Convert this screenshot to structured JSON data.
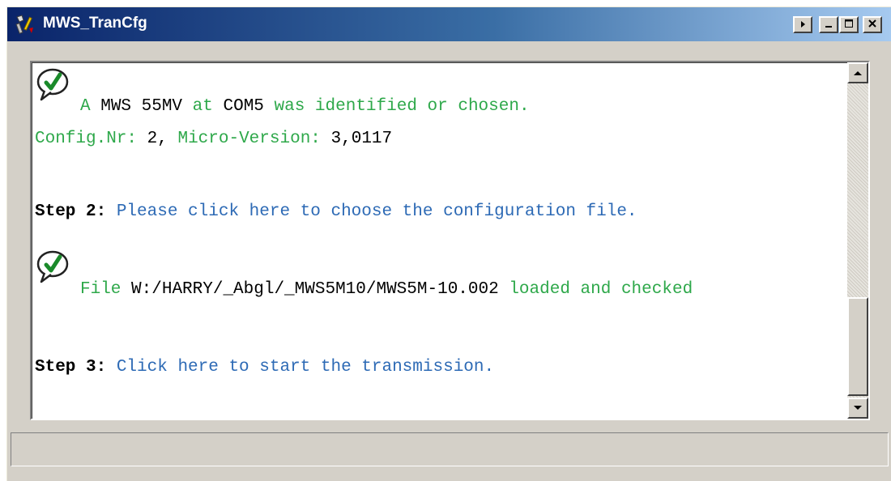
{
  "window": {
    "title": "MWS_TranCfg",
    "title_icon": "tools-icon",
    "titlebar_color_start": "#0a246a",
    "titlebar_color_end": "#a6caf0",
    "buttons": [
      "menu-arrow-icon",
      "minimize-icon",
      "maximize-icon",
      "close-icon"
    ]
  },
  "log": {
    "device": {
      "icon": "check-bubble-icon",
      "t1": "A",
      "t2": "MWS 55MV",
      "t3": "at",
      "t4": "COM5",
      "t5": "was identified or chosen."
    },
    "config": {
      "label": "Config.Nr:",
      "nr": "2,",
      "micro_label": "Micro-Version:",
      "micro_value": "3,0117"
    },
    "step2": {
      "label": "Step 2:",
      "action": "Please click here to choose the configuration file."
    },
    "file": {
      "icon": "check-bubble-icon",
      "prefix": "File",
      "path": "W:/HARRY/_Abgl/_MWS5M10/MWS5M-10.002",
      "status": "loaded and checked"
    },
    "step3": {
      "label": "Step 3:",
      "action": "Click here to start the transmission."
    }
  },
  "colors": {
    "success_green": "#2ea84a",
    "link_blue": "#2d6ab5",
    "window_face": "#d4d0c8"
  },
  "statusbar": {
    "text": ""
  }
}
